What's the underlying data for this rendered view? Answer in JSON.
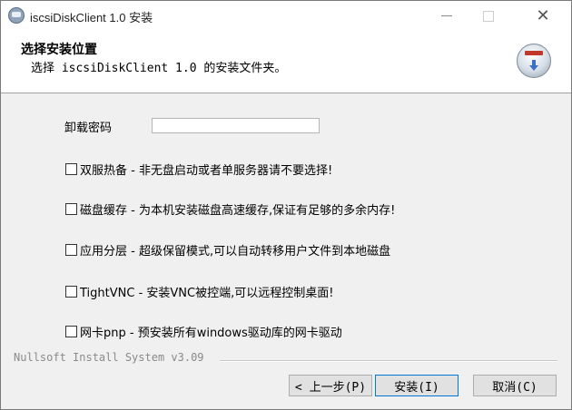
{
  "window": {
    "title": "iscsiDiskClient 1.0 安装",
    "controls": {
      "minimize": "—",
      "maximize": "",
      "close": "✕"
    }
  },
  "header": {
    "title": "选择安装位置",
    "subtitle": "选择 iscsiDiskClient 1.0 的安装文件夹。"
  },
  "form": {
    "password_label": "卸载密码",
    "password_value": "",
    "options": [
      {
        "label": "双服热备 - 非无盘启动或者单服务器请不要选择!",
        "checked": false
      },
      {
        "label": "磁盘缓存 - 为本机安装磁盘高速缓存,保证有足够的多余内存!",
        "checked": false
      },
      {
        "label": "应用分层 - 超级保留模式,可以自动转移用户文件到本地磁盘",
        "checked": false
      },
      {
        "label": "TightVNC - 安装VNC被控端,可以远程控制桌面!",
        "checked": false
      },
      {
        "label": "网卡pnp - 预安装所有windows驱动库的网卡驱动",
        "checked": false
      }
    ]
  },
  "footer": {
    "brand": "Nullsoft Install System v3.09",
    "buttons": {
      "back": "< 上一步(P)",
      "install": "安装(I)",
      "cancel": "取消(C)"
    }
  }
}
